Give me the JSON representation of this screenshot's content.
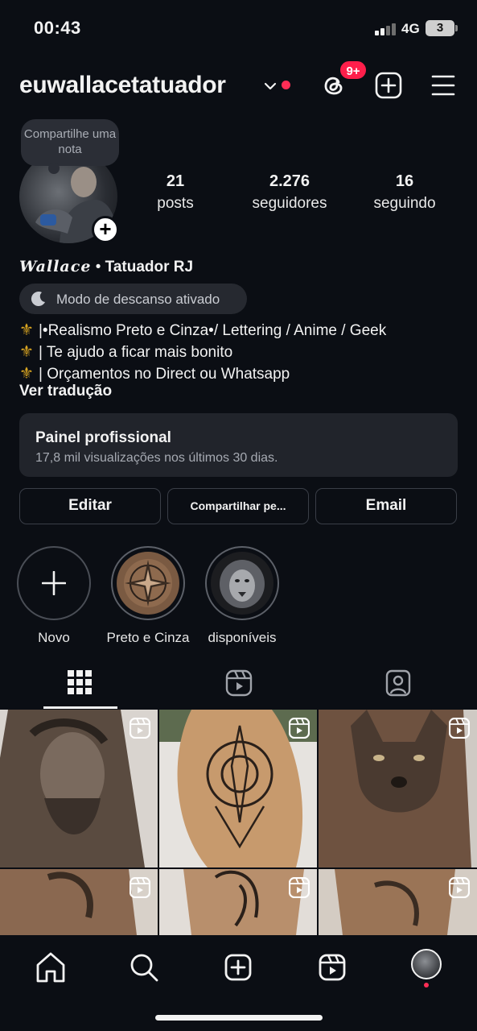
{
  "status": {
    "time": "00:43",
    "network": "4G",
    "battery": "3"
  },
  "header": {
    "username": "euwallacetatuador",
    "notifications_badge": "9+"
  },
  "profile": {
    "note_prompt": "Compartilhe uma nota",
    "stats": [
      {
        "value": "21",
        "label": "posts"
      },
      {
        "value": "2.276",
        "label": "seguidores"
      },
      {
        "value": "16",
        "label": "seguindo"
      }
    ],
    "name": "Wallace",
    "separator": "•",
    "category": "Tatuador RJ",
    "rest_mode": "Modo de descanso ativado",
    "bio_lines": [
      "|•Realismo Preto e Cinza•/ Lettering / Anime / Geek",
      "| Te ajudo a ficar mais bonito",
      "| Orçamentos no Direct ou Whatsapp"
    ],
    "bio_icon": "⚜",
    "translate": "Ver tradução"
  },
  "dashboard": {
    "title": "Painel profissional",
    "subtitle": "17,8 mil visualizações nos últimos 30 dias."
  },
  "actions": {
    "edit": "Editar",
    "share": "Compartilhar pe...",
    "email": "Email"
  },
  "highlights": [
    {
      "label": "Novo",
      "icon": "plus-icon"
    },
    {
      "label": "Preto e Cinza"
    },
    {
      "label": "disponíveis"
    }
  ],
  "tabs": [
    {
      "name": "grid-icon",
      "active": true
    },
    {
      "name": "reels-icon",
      "active": false
    },
    {
      "name": "tagged-icon",
      "active": false
    }
  ],
  "posts": [
    {
      "subject": "jesus-portrait-tattoo",
      "type": "reel"
    },
    {
      "subject": "mandala-tattoo",
      "type": "reel"
    },
    {
      "subject": "wolf-tattoo",
      "type": "reel"
    },
    {
      "subject": "tattoo",
      "type": "reel"
    },
    {
      "subject": "heart-tattoo",
      "type": "reel"
    },
    {
      "subject": "tattoo",
      "type": "reel"
    }
  ],
  "bottom_nav": [
    "home-icon",
    "search-icon",
    "create-icon",
    "reels-icon",
    "profile-avatar"
  ],
  "colors": {
    "background": "#0b0e14",
    "accent_red": "#ff1f4b",
    "surface": "#21242b",
    "text": "#f2f2f2"
  }
}
